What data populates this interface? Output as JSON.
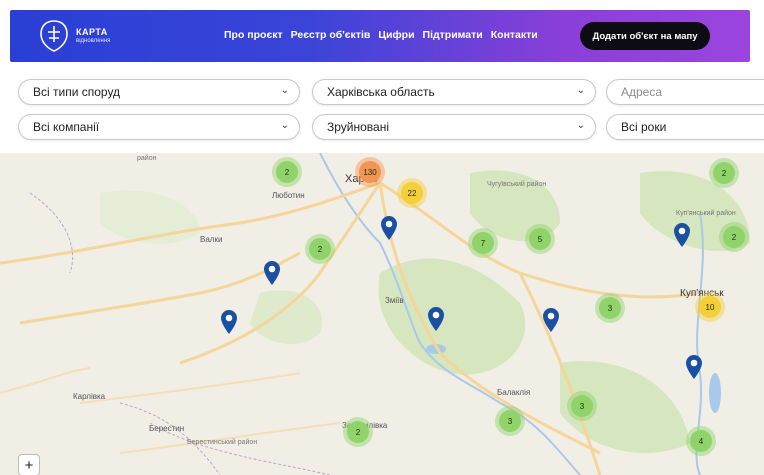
{
  "header": {
    "brand": {
      "title": "КАРТА",
      "subtitle": "відновлення"
    },
    "nav": [
      "Про проєкт",
      "Реєстр об'єктів",
      "Цифри",
      "Підтримати",
      "Контакти"
    ],
    "cta": "Додати об'єкт на мапу"
  },
  "filters": {
    "type": "Всі типи споруд",
    "region": "Харківська область",
    "address_placeholder": "Адреса",
    "company": "Всі компанії",
    "status": "Зруйновані",
    "years": "Всі роки"
  },
  "map": {
    "place_labels": [
      "Харків",
      "Люботин",
      "Валки",
      "Зміїв",
      "Балаклія",
      "Куп'янськ",
      "Куп'янський район",
      "Чугуївський район",
      "Карлівка",
      "Берестин",
      "Берестинський район",
      "Зачепилівка",
      "район"
    ],
    "clusters": [
      "130",
      "22",
      "2",
      "2",
      "7",
      "5",
      "2",
      "2",
      "3",
      "10",
      "3",
      "3",
      "2",
      "4"
    ],
    "zoom_in": "+"
  },
  "colors": {
    "cluster_green": "#8fd36a",
    "cluster_yellow": "#f4cf3a",
    "cluster_orange": "#f39552",
    "pin": "#1b4fa3"
  }
}
